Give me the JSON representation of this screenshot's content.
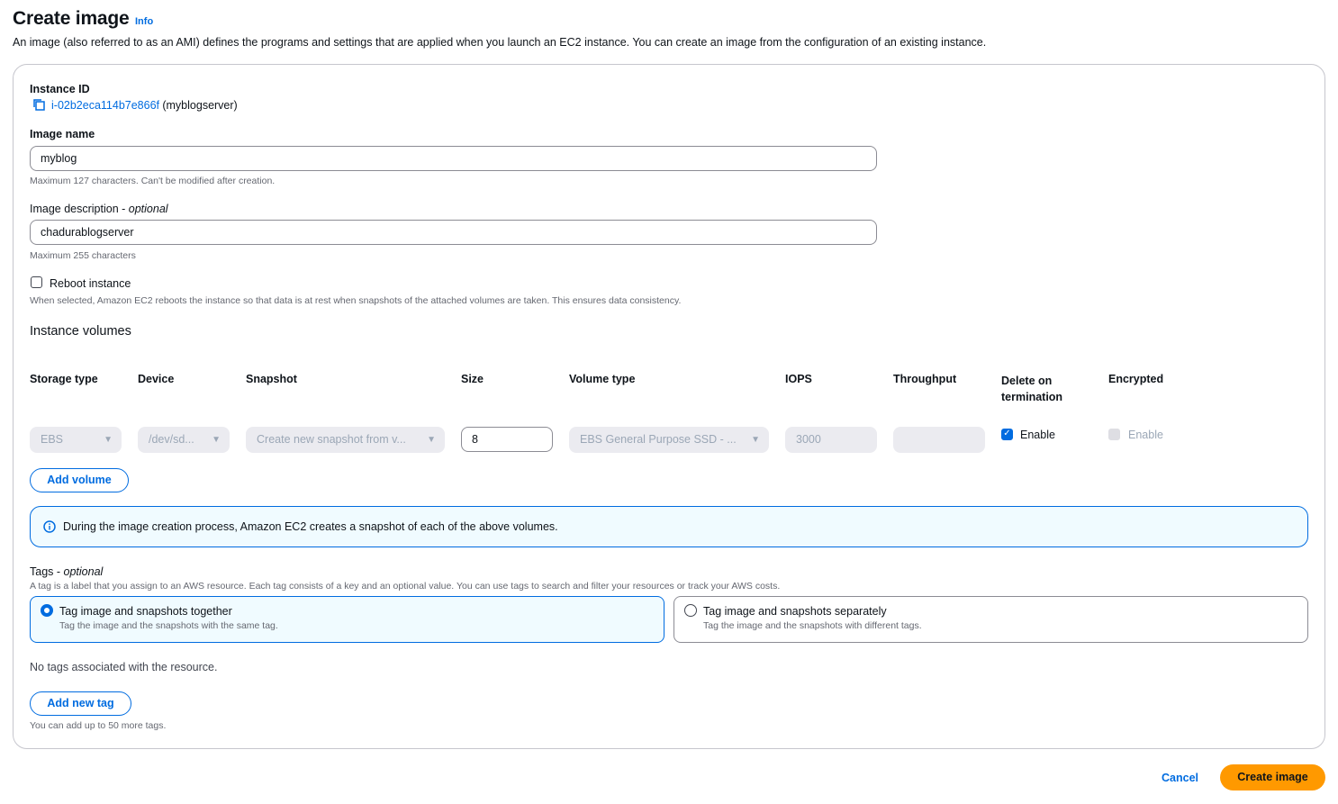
{
  "header": {
    "title": "Create image",
    "info": "Info",
    "description": "An image (also referred to as an AMI) defines the programs and settings that are applied when you launch an EC2 instance. You can create an image from the configuration of an existing instance."
  },
  "instance": {
    "label": "Instance ID",
    "id": "i-02b2eca114b7e866f",
    "name": "(myblogserver)"
  },
  "image_name": {
    "label": "Image name",
    "value": "myblog",
    "hint": "Maximum 127 characters. Can't be modified after creation."
  },
  "image_description": {
    "label": "Image description - ",
    "optional": "optional",
    "value": "chadurablogserver",
    "hint": "Maximum 255 characters"
  },
  "reboot": {
    "label": "Reboot instance",
    "hint": "When selected, Amazon EC2 reboots the instance so that data is at rest when snapshots of the attached volumes are taken. This ensures data consistency.",
    "checked": false
  },
  "volumes": {
    "section_title": "Instance volumes",
    "columns": [
      "Storage type",
      "Device",
      "Snapshot",
      "Size",
      "Volume type",
      "IOPS",
      "Throughput",
      "Delete on termination",
      "Encrypted"
    ],
    "row": {
      "storage_type": "EBS",
      "device": "/dev/sd...",
      "snapshot": "Create new snapshot from v...",
      "size": "8",
      "volume_type": "EBS General Purpose SSD - ...",
      "iops": "3000",
      "throughput": "",
      "delete_on_termination": "Enable",
      "encrypted": "Enable"
    },
    "add_volume": "Add volume"
  },
  "alert": {
    "text": "During the image creation process, Amazon EC2 creates a snapshot of each of the above volumes."
  },
  "tags": {
    "label": "Tags - ",
    "optional": "optional",
    "hint": "A tag is a label that you assign to an AWS resource. Each tag consists of a key and an optional value. You can use tags to search and filter your resources or track your AWS costs.",
    "options": [
      {
        "title": "Tag image and snapshots together",
        "desc": "Tag the image and the snapshots with the same tag.",
        "selected": true
      },
      {
        "title": "Tag image and snapshots separately",
        "desc": "Tag the image and the snapshots with different tags.",
        "selected": false
      }
    ],
    "empty": "No tags associated with the resource.",
    "add_tag": "Add new tag",
    "limit_hint": "You can add up to 50 more tags."
  },
  "footer": {
    "cancel": "Cancel",
    "create": "Create image"
  },
  "colors": {
    "accent": "#006ce0",
    "primary_button": "#ff9900"
  }
}
